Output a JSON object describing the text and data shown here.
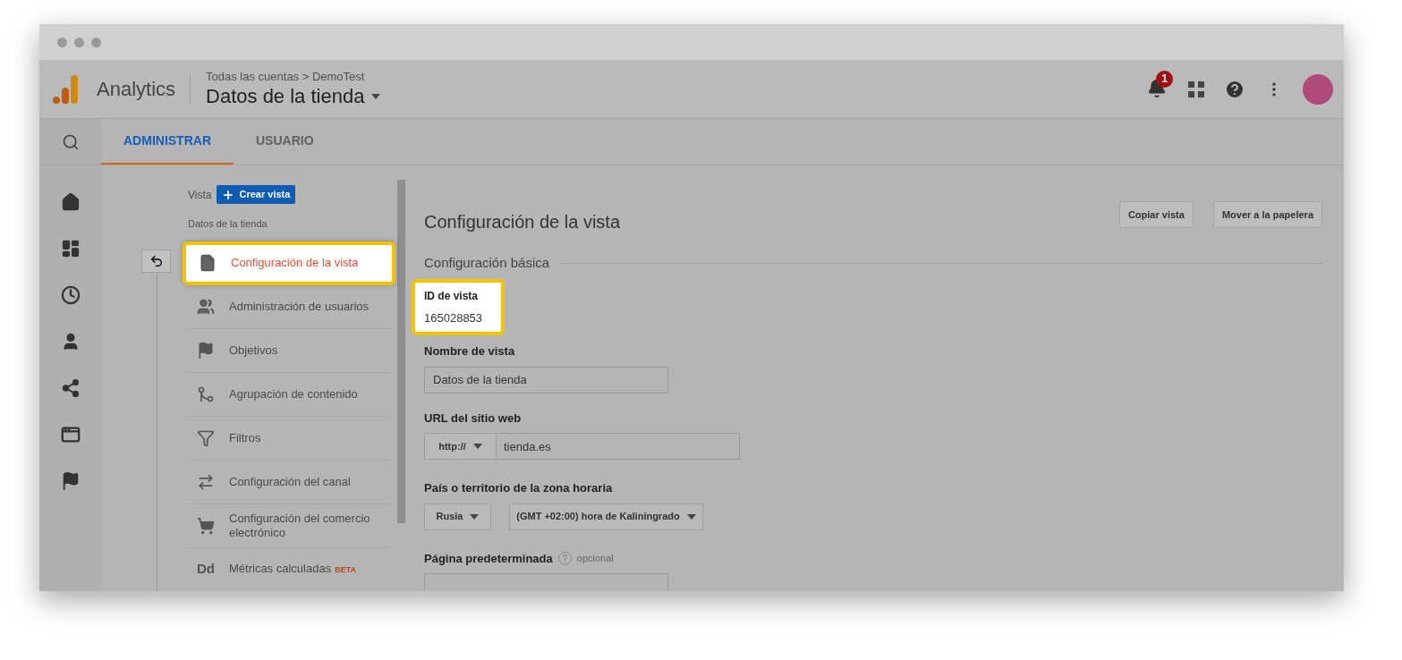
{
  "header": {
    "product": "Analytics",
    "breadcrumb": "Todas las cuentas > DemoTest",
    "property": "Datos de la tienda",
    "notification_count": "1"
  },
  "tabs": [
    {
      "label": "ADMINISTRAR",
      "selected": true
    },
    {
      "label": "USUARIO",
      "selected": false
    }
  ],
  "view_column": {
    "label": "Vista",
    "create_button": "Crear vista",
    "view_name": "Datos de la tienda",
    "items": [
      {
        "label": "Configuración de la vista",
        "selected": true,
        "highlighted": true
      },
      {
        "label": "Administración de usuarios",
        "selected": false,
        "highlighted": false
      },
      {
        "label": "Objetivos",
        "selected": false,
        "highlighted": false
      },
      {
        "label": "Agrupación de contenido",
        "selected": false,
        "highlighted": false
      },
      {
        "label": "Filtros",
        "selected": false,
        "highlighted": false
      },
      {
        "label": "Configuración del canal",
        "selected": false,
        "highlighted": false
      },
      {
        "label": "Configuración del comercio electrónico",
        "selected": false,
        "highlighted": false
      },
      {
        "label": "Métricas calculadas",
        "icon_text": "Dd",
        "badge": "BETA",
        "selected": false,
        "highlighted": false
      }
    ]
  },
  "content": {
    "title": "Configuración de la vista",
    "buttons": [
      "Copiar vista",
      "Mover a la papelera"
    ],
    "section": "Configuración básica",
    "view_id": {
      "label": "ID de vista",
      "value": "165028853",
      "highlighted": true
    },
    "view_name": {
      "label": "Nombre de vista",
      "value": "Datos de la tienda"
    },
    "website_url": {
      "label": "URL del sitio web",
      "protocol": "http://",
      "value": "tienda.es"
    },
    "timezone": {
      "label": "País o territorio de la zona horaria",
      "country": "Rusia",
      "zone": "(GMT +02:00) hora de Kaliningrado"
    },
    "default_page": {
      "label": "Página predeterminada",
      "help": "?",
      "optional": "opcional"
    }
  }
}
